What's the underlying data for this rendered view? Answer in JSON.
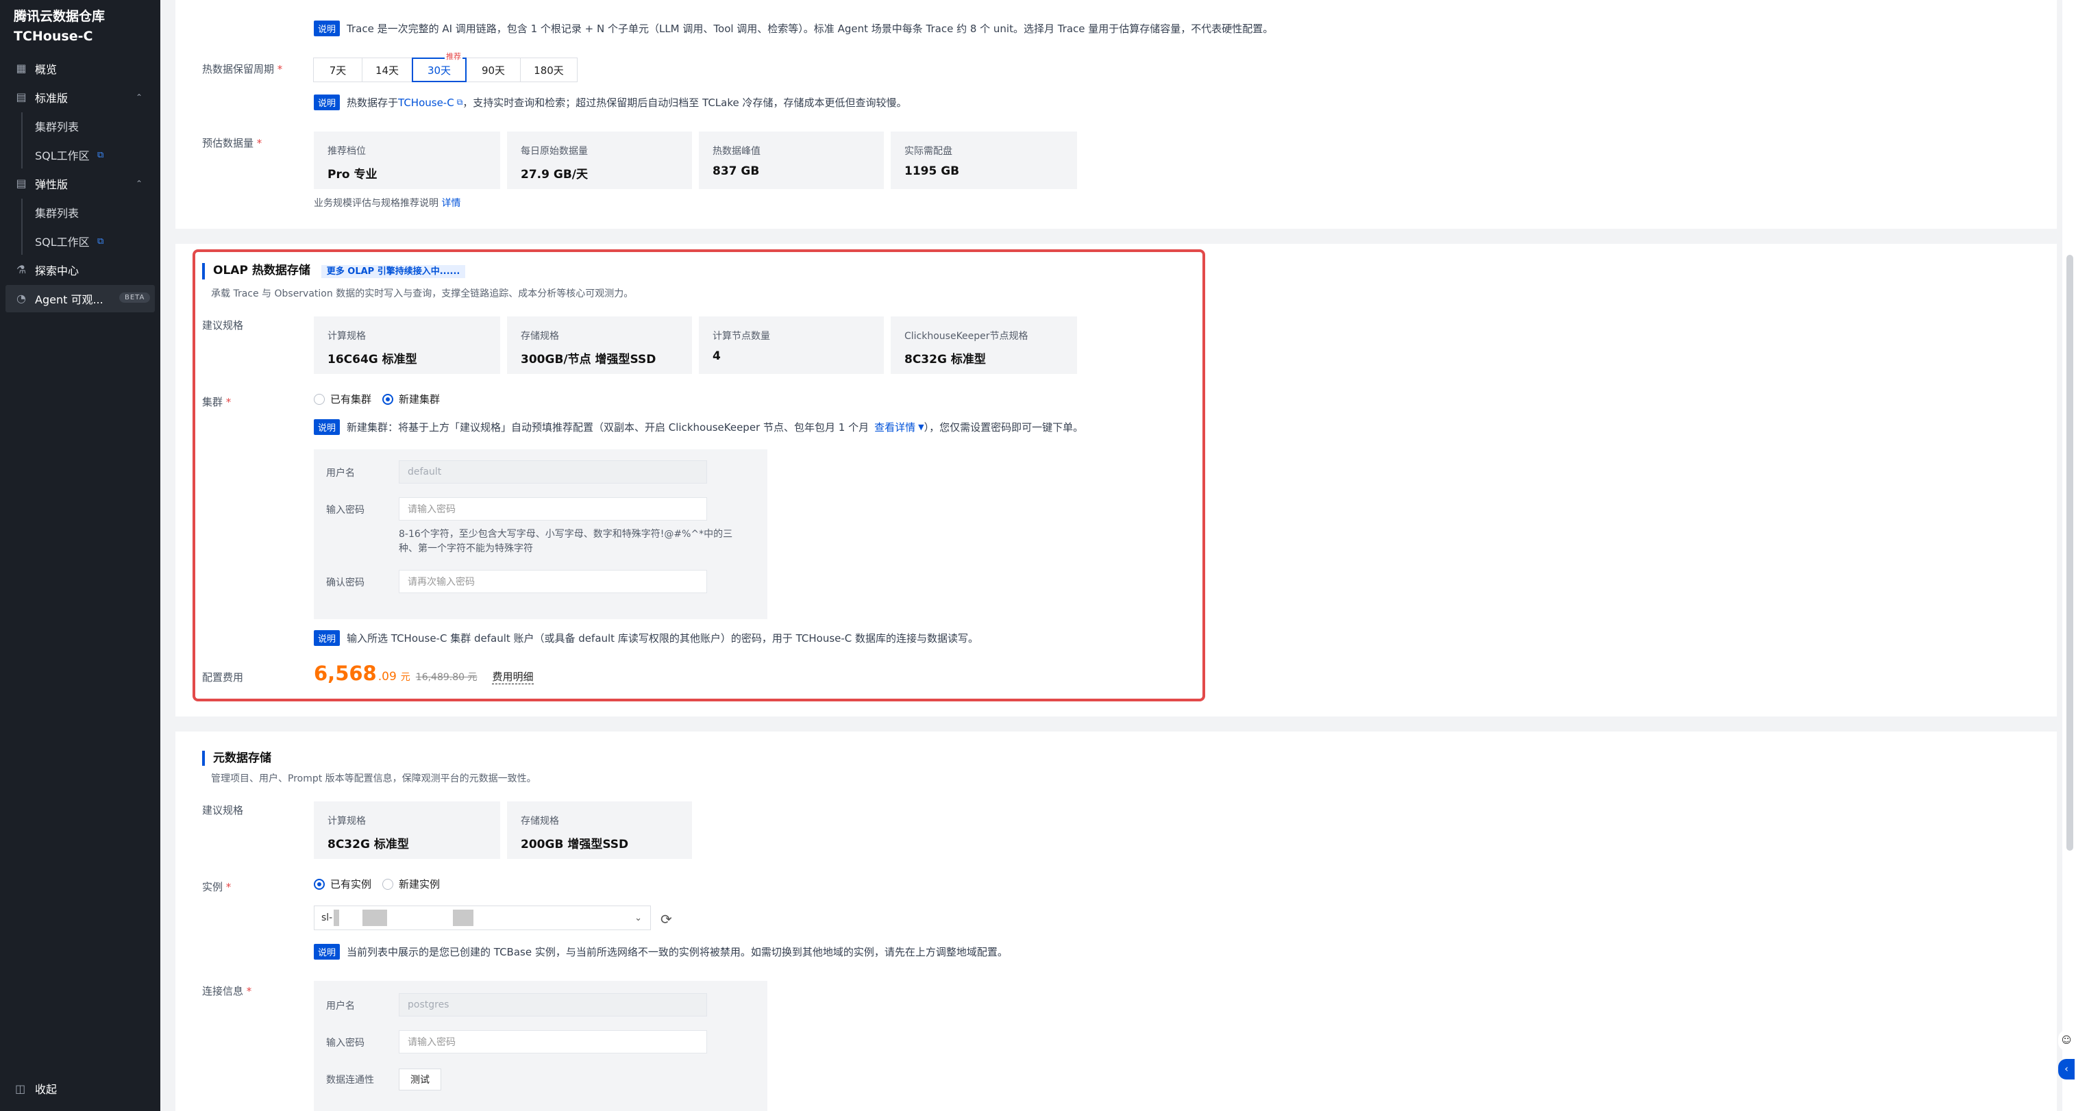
{
  "sidebar": {
    "brand_line1": "腾讯云数据仓库",
    "brand_line2": "TCHouse-C",
    "items": [
      {
        "label": "概览",
        "icon": "grid-icon"
      },
      {
        "label": "标准版",
        "icon": "table-icon"
      },
      {
        "label": "集群列表"
      },
      {
        "label": "SQL工作区",
        "icon": "external-link-icon"
      },
      {
        "label": "弹性版",
        "icon": "table-icon"
      },
      {
        "label": "集群列表"
      },
      {
        "label": "SQL工作区",
        "icon": "external-link-icon"
      },
      {
        "label": "探索中心",
        "icon": "explore-icon"
      },
      {
        "label": "Agent 可观...",
        "icon": "agent-icon",
        "badge": "BETA"
      }
    ],
    "collapse_label": "收起"
  },
  "trace": {
    "note_tag": "说明",
    "note": "Trace 是一次完整的 AI 调用链路，包含 1 个根记录 + N 个子单元（LLM 调用、Tool 调用、检索等）。标准 Agent 场景中每条 Trace 约 8 个 unit。选择月 Trace 量用于估算存储容量，不代表硬性配置。"
  },
  "retention": {
    "label": "热数据保留周期",
    "options": [
      "7天",
      "14天",
      "30天",
      "90天",
      "180天"
    ],
    "selected": "30天",
    "recommend_badge": "推荐",
    "note_tag": "说明",
    "note_prefix": "热数据存于 ",
    "note_link": "TCHouse-C",
    "note_suffix": "，支持实时查询和检索；超过热保留期后自动归档至 TCLake 冷存储，存储成本更低但查询较慢。"
  },
  "estimate": {
    "label": "预估数据量",
    "boxes": [
      {
        "k": "推荐档位",
        "v": "Pro 专业"
      },
      {
        "k": "每日原始数据量",
        "v": "27.9 GB/天"
      },
      {
        "k": "热数据峰值",
        "v": "837 GB"
      },
      {
        "k": "实际需配盘",
        "v": "1195 GB"
      }
    ],
    "footnote": "业务规模评估与规格推荐说明",
    "footnote_link": "详情"
  },
  "olap": {
    "title": "OLAP 热数据存储",
    "tag": "更多 OLAP 引擎持续接入中......",
    "desc": "承载 Trace 与 Observation 数据的实时写入与查询，支撑全链路追踪、成本分析等核心可观测力。",
    "spec_label": "建议规格",
    "specs": [
      {
        "k": "计算规格",
        "v": "16C64G 标准型"
      },
      {
        "k": "存储规格",
        "v": "300GB/节点 增强型SSD"
      },
      {
        "k": "计算节点数量",
        "v": "4"
      },
      {
        "k": "ClickhouseKeeper节点规格",
        "v": "8C32G 标准型"
      }
    ],
    "cluster_label": "集群",
    "cluster_options": [
      "已有集群",
      "新建集群"
    ],
    "cluster_selected": "新建集群",
    "cluster_note_tag": "说明",
    "cluster_note": "新建集群：将基于上方「建议规格」自动预填推荐配置（双副本、开启 ClickhouseKeeper 节点、包年包月 1 个月",
    "cluster_note_link": "查看详情",
    "cluster_note_suffix": "），您仅需设置密码即可一键下单。",
    "username_label": "用户名",
    "username_value": "default",
    "password_label": "输入密码",
    "password_placeholder": "请输入密码",
    "password_hint": "8-16个字符，至少包含大写字母、小写字母、数字和特殊字符!@#%^*中的三种、第一个字符不能为特殊字符",
    "confirm_label": "确认密码",
    "confirm_placeholder": "请再次输入密码",
    "account_note_tag": "说明",
    "account_note": "输入所选 TCHouse-C 集群 default 账户（或具备 default 库读写权限的其他账户）的密码，用于 TCHouse-C 数据库的连接与数据读写。",
    "cost_label": "配置费用",
    "price_int": "6,568",
    "price_dec": ".09",
    "price_unit": "元",
    "price_orig": "16,489.80 元",
    "price_detail": "费用明细"
  },
  "meta": {
    "title": "元数据存储",
    "desc": "管理项目、用户、Prompt 版本等配置信息，保障观测平台的元数据一致性。",
    "spec_label": "建议规格",
    "specs": [
      {
        "k": "计算规格",
        "v": "8C32G 标准型"
      },
      {
        "k": "存储规格",
        "v": "200GB 增强型SSD"
      }
    ],
    "instance_label": "实例",
    "instance_options": [
      "已有实例",
      "新建实例"
    ],
    "instance_selected": "已有实例",
    "select_prefix": "sl-",
    "instance_note_tag": "说明",
    "instance_note": "当前列表中展示的是您已创建的 TCBase 实例，与当前所选网络不一致的实例将被禁用。如需切换到其他地域的实例，请先在上方调整地域配置。",
    "conn_label": "连接信息",
    "username_label": "用户名",
    "username_value": "postgres",
    "password_label": "输入密码",
    "password_placeholder": "请输入密码",
    "connectivity_label": "数据连通性",
    "test_button": "测试"
  },
  "colors": {
    "accent": "#0052d9",
    "price": "#ff7200",
    "highlight": "#e24a4a",
    "sidebar_bg": "#1b1f26"
  }
}
